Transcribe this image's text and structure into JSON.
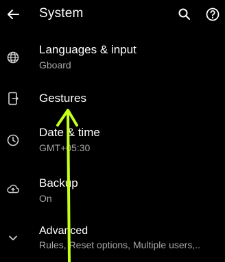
{
  "header": {
    "title": "System",
    "back_icon": "arrow-back-icon",
    "search_icon": "search-icon",
    "help_icon": "help-icon"
  },
  "items": [
    {
      "label": "Languages & input",
      "summary": "Gboard",
      "icon": "globe-icon"
    },
    {
      "label": "Gestures",
      "summary": "",
      "icon": "phone-gesture-icon"
    },
    {
      "label": "Date & time",
      "summary": "GMT+05:30",
      "icon": "clock-icon"
    },
    {
      "label": "Backup",
      "summary": "On",
      "icon": "cloud-upload-icon"
    },
    {
      "label": "Advanced",
      "summary": "Rules, Reset options, Multiple users,..",
      "icon": "chevron-down-icon"
    }
  ],
  "annotation": {
    "color": "#c6ff1a",
    "points_to": "Gestures"
  }
}
